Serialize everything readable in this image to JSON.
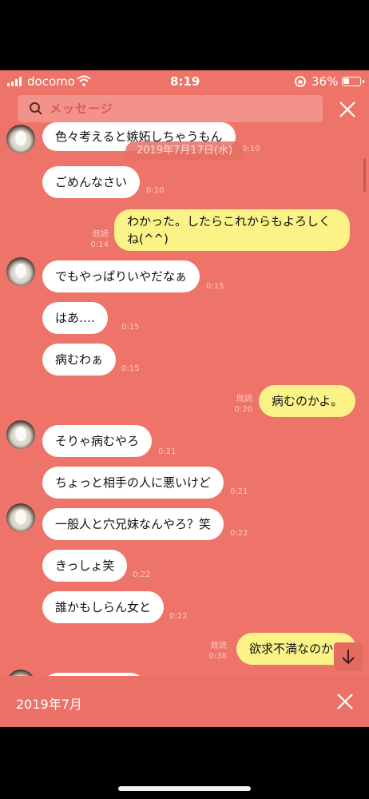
{
  "status_bar": {
    "carrier": "docomo",
    "time": "8:19",
    "battery": "36%"
  },
  "search": {
    "placeholder": "メッセージ"
  },
  "date_badge": "2019年7月17日(水)",
  "messages": [
    {
      "side": "left",
      "text": "色々考えると嫉妬しちゃうもん",
      "time": "0:10"
    },
    {
      "side": "left",
      "text": "ごめんなさい",
      "time": "0:10"
    },
    {
      "side": "right",
      "text": "わかった。したらこれからもよろしくね(^^)",
      "read": "既読",
      "time": "0:14"
    },
    {
      "side": "left",
      "text": "でもやっぱりいやだなぁ",
      "time": "0:15"
    },
    {
      "side": "left",
      "text": "はあ‥‥",
      "time": "0:15"
    },
    {
      "side": "left",
      "text": "病むわぁ",
      "time": "0:15"
    },
    {
      "side": "right",
      "text": "病むのかよ。",
      "read": "既読",
      "time": "0:20"
    },
    {
      "side": "left",
      "text": "そりゃ病むやろ",
      "time": "0:21"
    },
    {
      "side": "left",
      "text": "ちょっと相手の人に悪いけど",
      "time": "0:21"
    },
    {
      "side": "left",
      "text": "一般人と穴兄妹なんやろ？笑",
      "time": "0:22"
    },
    {
      "side": "left",
      "text": "きっしょ笑",
      "time": "0:22"
    },
    {
      "side": "left",
      "text": "誰かもしらん女と",
      "time": "0:22"
    },
    {
      "side": "right",
      "text": "欲求不満なのか",
      "read": "既読",
      "time": "0:38"
    }
  ],
  "bottom_bar": {
    "month": "2019年7月"
  },
  "colors": {
    "background": "#ee7469",
    "left_bubble": "#ffffff",
    "right_bubble": "#fbf387"
  }
}
